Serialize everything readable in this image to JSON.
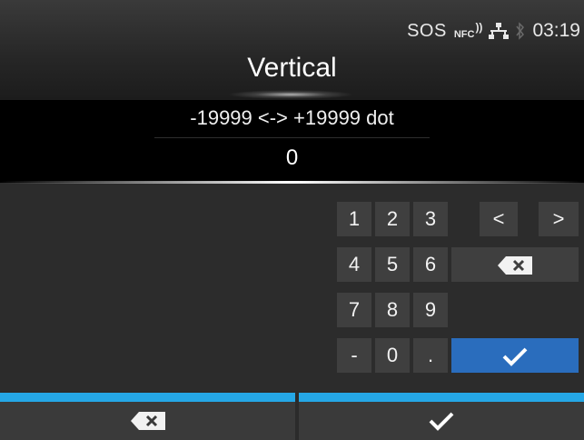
{
  "status_bar": {
    "sos": "SOS",
    "nfc": "NFC",
    "time": "03:19",
    "icons": [
      "nfc-icon",
      "network-icon",
      "bluetooth-icon"
    ]
  },
  "title": "Vertical",
  "range": "-19999 <-> +19999 dot",
  "value": "0",
  "keypad": {
    "k1": "1",
    "k2": "2",
    "k3": "3",
    "left": "<",
    "right": ">",
    "k4": "4",
    "k5": "5",
    "k6": "6",
    "k7": "7",
    "k8": "8",
    "k9": "9",
    "minus": "-",
    "k0": "0",
    "dot": "."
  },
  "colors": {
    "accent_line": "#25a7e6",
    "ok_key": "#2a6dbd",
    "key_bg": "#3f3f3f"
  }
}
